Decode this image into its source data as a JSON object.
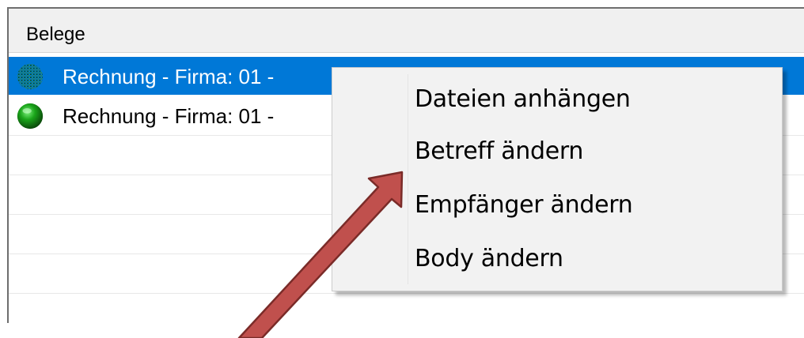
{
  "list": {
    "header_label": "Belege",
    "rows": [
      {
        "text": "Rechnung - Firma: 01 -",
        "selected": true
      },
      {
        "text": "Rechnung - Firma: 01 -",
        "selected": false
      }
    ]
  },
  "context_menu": {
    "items": [
      {
        "label": "Dateien anhängen"
      },
      {
        "label": "Betreff ändern"
      },
      {
        "label": "Empfänger ändern"
      },
      {
        "label": "Body ändern"
      }
    ]
  },
  "annotation": {
    "arrow_color": "#c0504d",
    "arrow_outline": "#7a2b28"
  },
  "colors": {
    "selection": "#0078d7",
    "status_icon": "#1aa51a"
  }
}
